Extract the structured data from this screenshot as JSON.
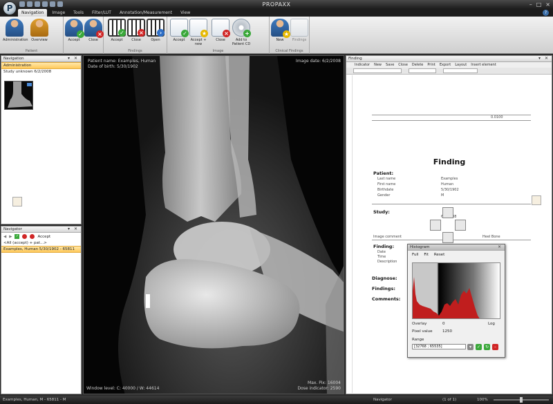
{
  "app": {
    "title": "PROPAXX",
    "logo_letter": "P",
    "tabs": [
      "Navigation",
      "Image",
      "Tools",
      "Filter/LUT",
      "Annotation/Measurement",
      "View"
    ],
    "active_tab": "Navigation",
    "help": "?",
    "window_controls": [
      "–",
      "□",
      "×"
    ]
  },
  "ribbon": {
    "groups": [
      {
        "name": "Patient",
        "buttons": [
          "Administration",
          "Overview",
          "Accept",
          "Close"
        ]
      },
      {
        "name": "Findings",
        "buttons": [
          "Accept",
          "Close",
          "Open"
        ]
      },
      {
        "name": "Image",
        "buttons": [
          "Accept",
          "Accept + new",
          "Close",
          "Add to Patient CD"
        ]
      },
      {
        "name": "Clinical Findings",
        "buttons": [
          "New",
          "Findings"
        ]
      }
    ]
  },
  "navigation": {
    "header": "Navigation",
    "selected": "Administration",
    "study": "Study unknown 6/2/2008"
  },
  "worklist": {
    "header": "Navigator",
    "toolbar_label": "Accept",
    "group_label": "<All (accept) + pat...>",
    "selected_item": "Examples, Human 5/30/1902 - 65811"
  },
  "viewer": {
    "patient_name": "Patient name: Examples, Human",
    "dob": "Date of birth: 5/30/1902",
    "image_date": "Image date: 6/2/2008",
    "window_level": "Window level: C: 40000 / W: 44614",
    "max_pix": "Max. Pix: 16004",
    "dose": "Dose indicator: 2590"
  },
  "report": {
    "header": "Finding",
    "toolbar": [
      "Indicator",
      "New",
      "Save",
      "Close",
      "Delete",
      "Print",
      "Export",
      "Layout",
      "Insert element"
    ],
    "title": "Finding",
    "sections": [
      "Patient:",
      "Study:",
      "Finding:",
      "Diagnose:",
      "Findings:",
      "Comments:"
    ],
    "dicom_value": "0.0100",
    "patient_rows": [
      "Last name",
      "First name",
      "Birthdate",
      "Gender"
    ],
    "patient_values": [
      "Examples",
      "Human",
      "5/30/1902",
      "M"
    ],
    "date_value": "6/2/2008",
    "image_comment_label": "Image comment",
    "image_comment": "Heel Bone",
    "finding_rows": [
      "Date",
      "Time",
      "Description"
    ]
  },
  "histogram": {
    "header": "Histogram",
    "modes": [
      "Full",
      "Fit",
      "Reset"
    ],
    "percent_label": "Overlay",
    "percent_value": "0",
    "log_label": "Log",
    "value_label": "Pixel value",
    "value": "1250",
    "range_label": "Range",
    "range_value": "[32768 ; 65535]",
    "range_separator": ";",
    "close": "×"
  },
  "status": {
    "left": "Examples, Human, M - 65811 - M",
    "middle": "Navigator",
    "right": "(1 of 1)",
    "zoom": "100%"
  },
  "colors": {
    "highlight": "#ffc95a",
    "hist_fill": "#c01e1e",
    "accept": "#3aa83a",
    "close": "#d02626"
  }
}
